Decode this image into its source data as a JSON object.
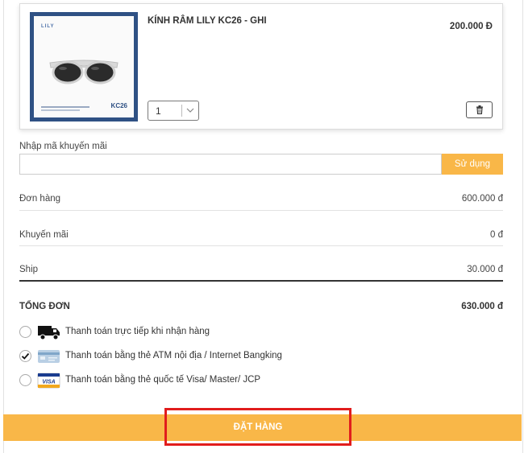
{
  "product": {
    "name": "KÍNH RÂM LILY KC26 - GHI",
    "price": "200.000 Đ",
    "image_brand": "LILY",
    "image_sku": "KC26",
    "quantity": "1"
  },
  "promo": {
    "label": "Nhập mã khuyến mãi",
    "input_value": "",
    "apply_label": "Sử dụng"
  },
  "summary": {
    "order_label": "Đơn hàng",
    "order_value": "600.000 đ",
    "discount_label": "Khuyến mãi",
    "discount_value": "0 đ",
    "ship_label": "Ship",
    "ship_value": "30.000 đ",
    "total_label": "TỔNG ĐƠN",
    "total_value": "630.000 đ"
  },
  "payment": {
    "options": [
      {
        "label": "Thanh toán trực tiếp khi nhận hàng",
        "icon": "truck-icon",
        "selected": false
      },
      {
        "label": "Thanh toán bằng thẻ ATM nội địa / Internet Bangking",
        "icon": "atm-card-icon",
        "selected": true
      },
      {
        "label": "Thanh toán bằng thẻ quốc tế Visa/ Master/ JCP",
        "icon": "visa-card-icon",
        "selected": false
      }
    ],
    "visa_text": "VISA"
  },
  "order": {
    "button_label": "ĐẶT HÀNG"
  },
  "colors": {
    "accent": "#f9b748",
    "highlight_border": "#e11d1d",
    "thumb_frame": "#2f5184"
  }
}
